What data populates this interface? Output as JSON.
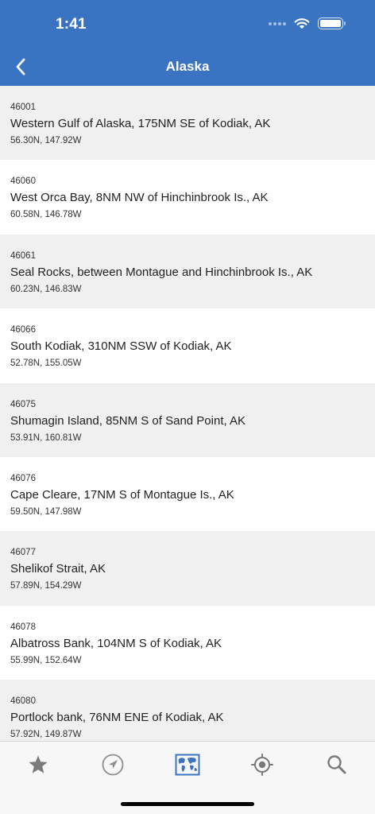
{
  "status_bar": {
    "time": "1:41"
  },
  "nav": {
    "title": "Alaska",
    "back_icon": "chevron-left-icon"
  },
  "colors": {
    "header": "#3a73c2",
    "row_alt": "#f0f0f0",
    "tab_active": "#3a73c2",
    "tab_inactive": "#8e8e8e"
  },
  "stations": [
    {
      "id": "46001",
      "name": "Western Gulf of Alaska, 175NM SE of Kodiak, AK",
      "coords": "56.30N, 147.92W"
    },
    {
      "id": "46060",
      "name": "West Orca Bay, 8NM NW of Hinchinbrook Is., AK",
      "coords": "60.58N, 146.78W"
    },
    {
      "id": "46061",
      "name": "Seal Rocks, between Montague and Hinchinbrook Is., AK",
      "coords": "60.23N, 146.83W"
    },
    {
      "id": "46066",
      "name": "South Kodiak, 310NM SSW of Kodiak, AK",
      "coords": "52.78N, 155.05W"
    },
    {
      "id": "46075",
      "name": "Shumagin Island, 85NM S of Sand Point, AK",
      "coords": "53.91N, 160.81W"
    },
    {
      "id": "46076",
      "name": "Cape Cleare, 17NM S of Montague Is., AK",
      "coords": "59.50N, 147.98W"
    },
    {
      "id": "46077",
      "name": "Shelikof Strait, AK",
      "coords": "57.89N, 154.29W"
    },
    {
      "id": "46078",
      "name": "Albatross Bank, 104NM S of Kodiak, AK",
      "coords": "55.99N, 152.64W"
    },
    {
      "id": "46080",
      "name": "Portlock bank, 76NM ENE of Kodiak, AK",
      "coords": "57.92N, 149.87W"
    }
  ],
  "tabs": [
    {
      "icon": "star-icon",
      "active": false
    },
    {
      "icon": "navigation-arrow-icon",
      "active": false
    },
    {
      "icon": "map-icon",
      "active": true
    },
    {
      "icon": "location-target-icon",
      "active": false
    },
    {
      "icon": "search-icon",
      "active": false
    }
  ]
}
